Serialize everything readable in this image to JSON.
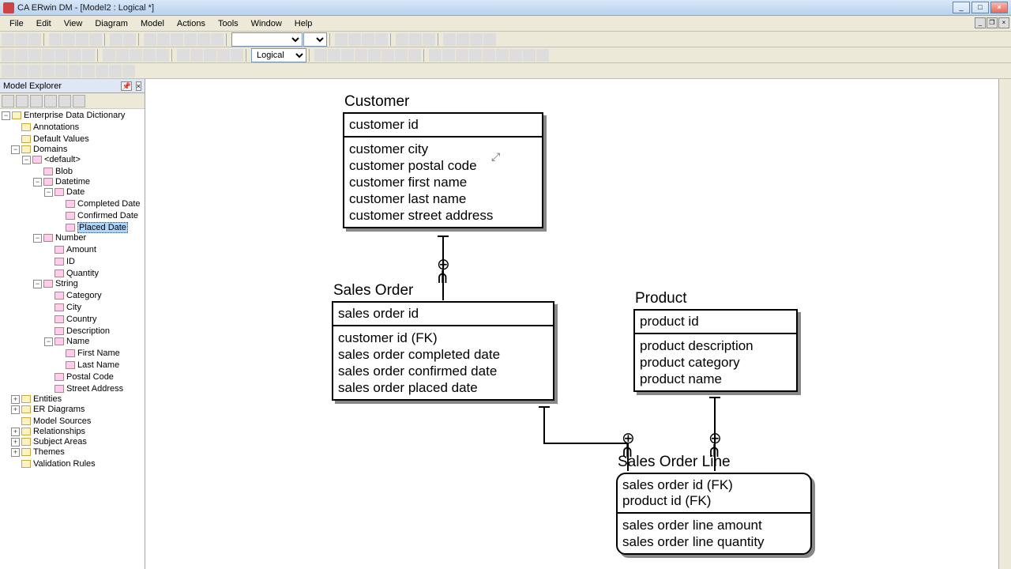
{
  "window": {
    "title": "CA ERwin DM - [Model2 : Logical *]"
  },
  "menus": [
    "File",
    "Edit",
    "View",
    "Diagram",
    "Model",
    "Actions",
    "Tools",
    "Window",
    "Help"
  ],
  "toolbar_combo": "Logical",
  "explorer": {
    "title": "Model Explorer",
    "tree": {
      "eddict": "Enterprise Data Dictionary",
      "annotations": "Annotations",
      "default_values": "Default Values",
      "domains": "Domains",
      "default": "<default>",
      "blob": "Blob",
      "datetime": "Datetime",
      "date": "Date",
      "completed_date": "Completed Date",
      "confirmed_date": "Confirmed Date",
      "placed_date": "Placed Date",
      "number": "Number",
      "amount": "Amount",
      "id": "ID",
      "quantity": "Quantity",
      "string": "String",
      "category": "Category",
      "city": "City",
      "country": "Country",
      "description": "Description",
      "name": "Name",
      "first_name": "First Name",
      "last_name": "Last Name",
      "postal_code": "Postal Code",
      "street_address": "Street Address",
      "entities": "Entities",
      "er_diagrams": "ER Diagrams",
      "model_sources": "Model Sources",
      "relationships": "Relationships",
      "subject_areas": "Subject Areas",
      "themes": "Themes",
      "validation_rules": "Validation Rules"
    }
  },
  "entities": {
    "customer": {
      "name": "Customer",
      "pk": "customer id",
      "attrs": [
        "customer city",
        "customer postal code",
        "customer first name",
        "customer last name",
        "customer street address"
      ]
    },
    "sales_order": {
      "name": "Sales Order",
      "pk": "sales order id",
      "attrs": [
        "customer id (FK)",
        "sales order completed date",
        "sales order confirmed date",
        "sales order placed date"
      ]
    },
    "product": {
      "name": "Product",
      "pk": "product id",
      "attrs": [
        "product description",
        "product category",
        "product name"
      ]
    },
    "sales_order_line": {
      "name": "Sales Order Line",
      "pk": [
        "sales order id (FK)",
        "product id (FK)"
      ],
      "attrs": [
        "sales order line amount",
        "sales order line quantity"
      ]
    }
  }
}
